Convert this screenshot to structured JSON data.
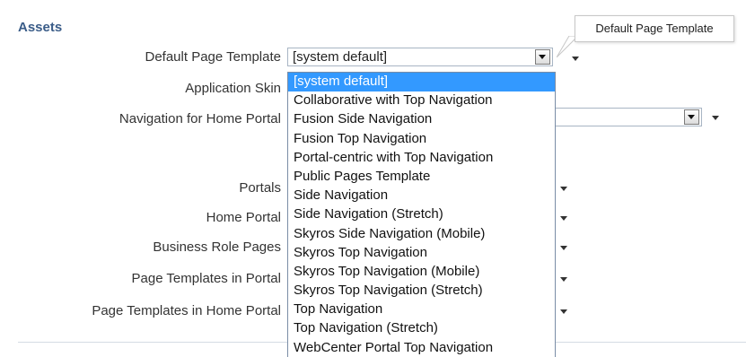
{
  "section": {
    "title": "Assets"
  },
  "fields": [
    {
      "label": "Default Page Template",
      "value": "[system default]"
    },
    {
      "label": "Application Skin"
    },
    {
      "label": "Navigation for Home Portal"
    },
    {
      "label": "Portals"
    },
    {
      "label": "Home Portal"
    },
    {
      "label": "Business Role Pages"
    },
    {
      "label": "Page Templates in Portal"
    },
    {
      "label": "Page Templates in Home Portal"
    }
  ],
  "dropdown": {
    "options": [
      "[system default]",
      "Collaborative with Top Navigation",
      "Fusion Side Navigation",
      "Fusion Top Navigation",
      "Portal-centric with Top Navigation",
      "Public Pages Template",
      "Side Navigation",
      "Side Navigation (Stretch)",
      "Skyros Side Navigation (Mobile)",
      "Skyros Top Navigation",
      "Skyros Top Navigation (Mobile)",
      "Skyros Top Navigation (Stretch)",
      "Top Navigation",
      "Top Navigation (Stretch)",
      "WebCenter Portal Top Navigation"
    ],
    "selected_index": 0
  },
  "tooltip": {
    "text": "Default Page Template"
  },
  "icons": {
    "dropdown_button": "chevron-down-icon",
    "field_menu": "caret-down-icon"
  },
  "colors": {
    "section_title": "#3a5c88",
    "selected_option_bg": "#3399ff"
  }
}
